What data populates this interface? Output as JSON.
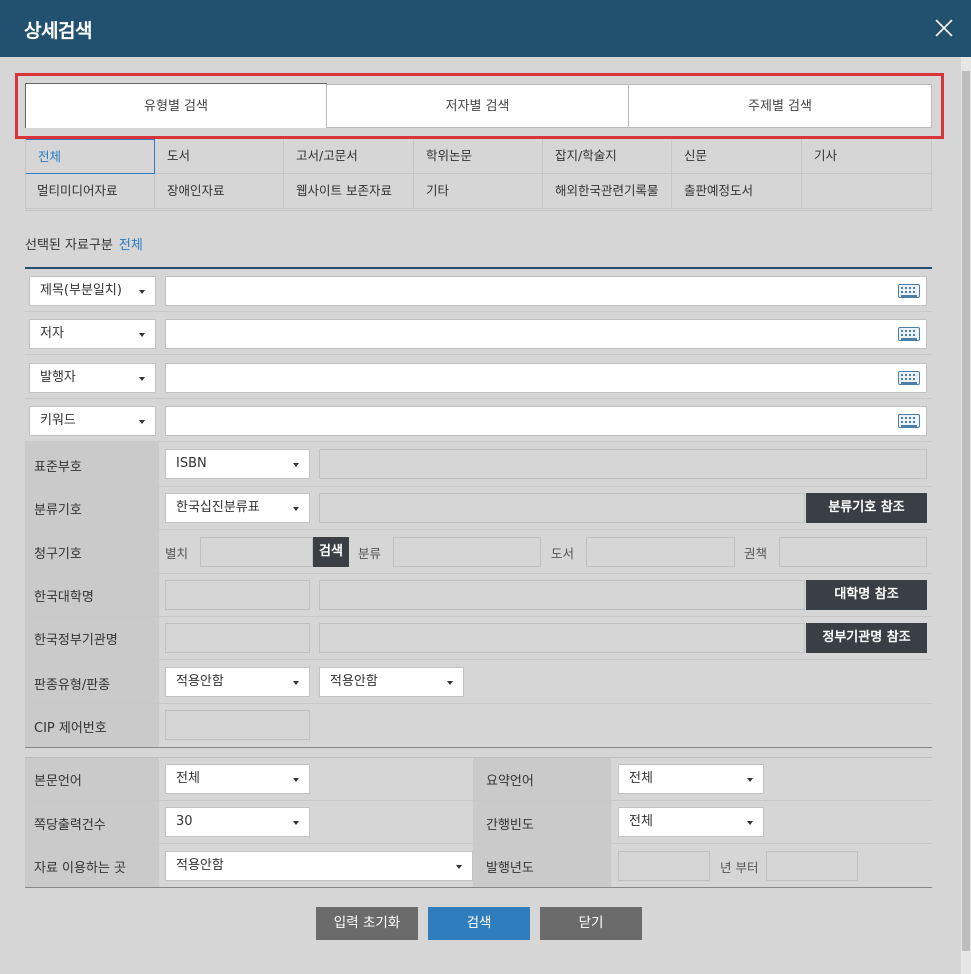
{
  "header": {
    "title": "상세검색"
  },
  "tabs": [
    {
      "label": "유형별 검색"
    },
    {
      "label": "저자별 검색"
    },
    {
      "label": "주제별 검색"
    }
  ],
  "material_types": {
    "row1": [
      "전체",
      "도서",
      "고서/고문서",
      "학위논문",
      "잡지/학술지",
      "신문",
      "기사"
    ],
    "row2": [
      "멀티미디어자료",
      "장애인자료",
      "웹사이트 보존자료",
      "기타",
      "해외한국관련기록물",
      "출판예정도서",
      ""
    ]
  },
  "selected": {
    "label": "선택된 자료구분",
    "value": "전체"
  },
  "search_fields": [
    {
      "field": "제목(부분일치)",
      "value": ""
    },
    {
      "field": "저자",
      "value": ""
    },
    {
      "field": "발행자",
      "value": ""
    },
    {
      "field": "키워드",
      "value": ""
    }
  ],
  "standard_no": {
    "label": "표준부호",
    "option": "ISBN"
  },
  "classification": {
    "label": "분류기호",
    "option": "한국십진분류표",
    "ref_button": "분류기호 참조"
  },
  "call_no": {
    "label": "청구기호",
    "separate": "별치",
    "search_button": "검색",
    "class": "분류",
    "book": "도서",
    "volume": "권책"
  },
  "university": {
    "label": "한국대학명",
    "ref_button": "대학명 참조"
  },
  "gov_agency": {
    "label": "한국정부기관명",
    "ref_button": "정부기관명 참조"
  },
  "edition": {
    "label": "판종유형/판종",
    "option1": "적용안함",
    "option2": "적용안함"
  },
  "cip": {
    "label": "CIP 제어번호"
  },
  "filters": {
    "body_lang": {
      "label": "본문언어",
      "option": "전체"
    },
    "summary_lang": {
      "label": "요약언어",
      "option": "전체"
    },
    "per_page": {
      "label": "쪽당출력건수",
      "option": "30"
    },
    "frequency": {
      "label": "간행빈도",
      "option": "전체"
    },
    "location": {
      "label": "자료 이용하는 곳",
      "option": "적용안함"
    },
    "pub_year": {
      "label": "발행년도",
      "from_label": "년 부터"
    }
  },
  "footer": {
    "reset": "입력 초기화",
    "search": "검색",
    "close": "닫기"
  },
  "colors": {
    "header": "#22506f",
    "accent": "#2a7ac4",
    "highlight": "#d9343a",
    "dark_button": "#3a3f45"
  }
}
